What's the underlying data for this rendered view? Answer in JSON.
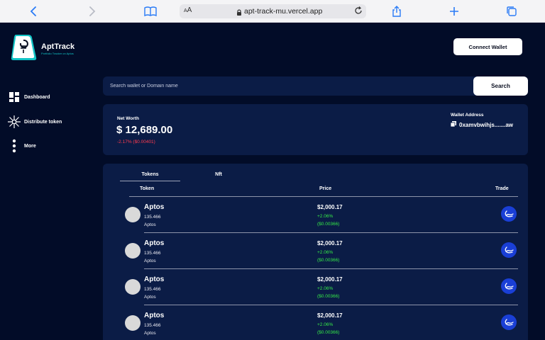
{
  "browser": {
    "text_size_label": "AA",
    "url": "apt-track-mu.vercel.app"
  },
  "brand": {
    "name": "AptTrack",
    "tagline": "Portfolio Tracker on Aptos",
    "accent_color": "#12c4c6"
  },
  "sidebar": {
    "items": [
      {
        "label": "Dashboard",
        "icon": "dashboard-grid-icon"
      },
      {
        "label": "Distribute token",
        "icon": "distribute-icon"
      },
      {
        "label": "More",
        "icon": "more-vertical-icon"
      }
    ]
  },
  "header": {
    "connect_label": "Connect Wallet"
  },
  "search": {
    "placeholder": "Search wallet or Domain name",
    "button_label": "Search"
  },
  "net_worth": {
    "label": "Net Worth",
    "value": "$ 12,689.00",
    "change": "-2.17% ($0.00401)",
    "change_color": "#ff3b4e"
  },
  "wallet": {
    "label": "Wallet Address",
    "value": "0xamvbwihjs.......aw"
  },
  "tabs": [
    {
      "label": "Tokens",
      "active": true
    },
    {
      "label": "Nft",
      "active": false
    }
  ],
  "table": {
    "headers": {
      "token": "Token",
      "price": "Price",
      "trade": "Trade"
    },
    "rows": [
      {
        "name": "Aptos",
        "amount": "135.466",
        "symbol": "Aptos",
        "price": "$2,000.17",
        "percent": "+2.06%",
        "change": "($0.00366)"
      },
      {
        "name": "Aptos",
        "amount": "135.466",
        "symbol": "Aptos",
        "price": "$2,000.17",
        "percent": "+2.06%",
        "change": "($0.00366)"
      },
      {
        "name": "Aptos",
        "amount": "135.466",
        "symbol": "Aptos",
        "price": "$2,000.17",
        "percent": "+2.06%",
        "change": "($0.00366)"
      },
      {
        "name": "Aptos",
        "amount": "135.466",
        "symbol": "Aptos",
        "price": "$2,000.17",
        "percent": "+2.06%",
        "change": "($0.00366)"
      }
    ],
    "positive_color": "#35ea47",
    "trade_button_color": "#1a3fd6"
  }
}
